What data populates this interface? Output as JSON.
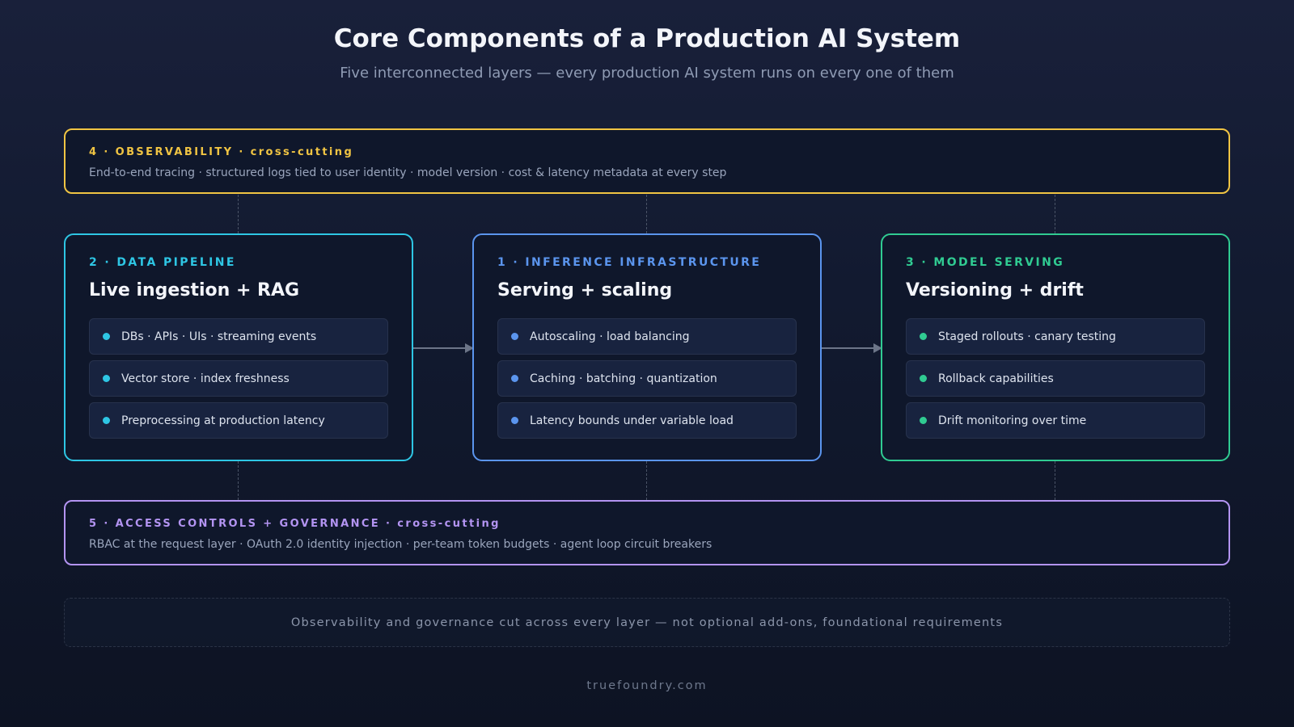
{
  "header": {
    "title": "Core Components of a Production AI System",
    "subtitle": "Five interconnected layers — every production AI system runs on every one of them"
  },
  "observability": {
    "heading": "4 · OBSERVABILITY · cross-cutting",
    "text": "End-to-end tracing · structured logs tied to user identity · model version · cost & latency metadata at every step",
    "color": "#f0c443"
  },
  "cards": [
    {
      "label": "2 · DATA PIPELINE",
      "title": "Live ingestion + RAG",
      "color": "#2ec6e4",
      "items": [
        "DBs · APIs · UIs · streaming events",
        "Vector store · index freshness",
        "Preprocessing at production latency"
      ]
    },
    {
      "label": "1 · INFERENCE INFRASTRUCTURE",
      "title": "Serving + scaling",
      "color": "#5b95ee",
      "items": [
        "Autoscaling · load balancing",
        "Caching · batching · quantization",
        "Latency bounds under variable load"
      ]
    },
    {
      "label": "3 · MODEL SERVING",
      "title": "Versioning + drift",
      "color": "#30cb92",
      "items": [
        "Staged rollouts · canary testing",
        "Rollback capabilities",
        "Drift monitoring over time"
      ]
    }
  ],
  "governance": {
    "heading": "5 · ACCESS CONTROLS + GOVERNANCE · cross-cutting",
    "text": "RBAC at the request layer · OAuth 2.0 identity injection · per-team token budgets · agent loop circuit breakers",
    "color": "#b394f2"
  },
  "note": "Observability and governance cut across every layer — not optional add-ons, foundational requirements",
  "footer": "truefoundry.com"
}
